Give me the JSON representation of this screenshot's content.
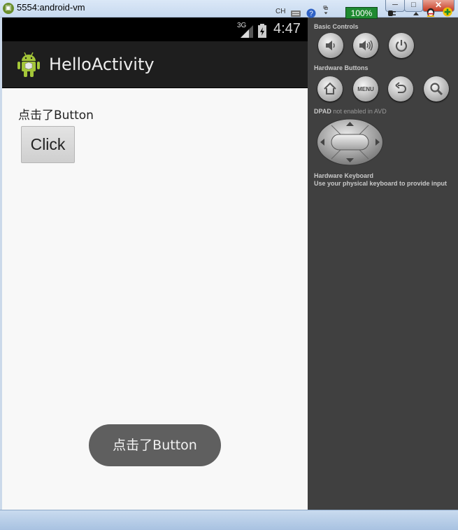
{
  "window": {
    "title": "5554:android-vm",
    "min_glyph": "─",
    "max_glyph": "□",
    "close_glyph": "✕"
  },
  "statusbar": {
    "network": "3G",
    "time": "4:47"
  },
  "actionbar": {
    "title": "HelloActivity"
  },
  "content": {
    "result_text": "点击了Button",
    "button_label": "Click",
    "toast_text": "点击了Button"
  },
  "controls": {
    "basic_controls_label": "Basic Controls",
    "hardware_buttons_label": "Hardware Buttons",
    "menu_label": "MENU",
    "dpad_label": "DPAD",
    "dpad_note": "not enabled in AVD",
    "keyboard_label": "Hardware Keyboard",
    "keyboard_note": "Use your physical keyboard to provide input",
    "buttons": [
      "volume-down-icon",
      "volume-up-icon",
      "power-icon",
      "home-icon",
      "menu-icon",
      "back-icon",
      "search-icon"
    ]
  },
  "taskbar": {
    "lang": "CH",
    "zoom": "100%"
  },
  "colors": {
    "accent_green": "#a4c639",
    "panel": "#404040",
    "toast": "#5f5f5f"
  }
}
